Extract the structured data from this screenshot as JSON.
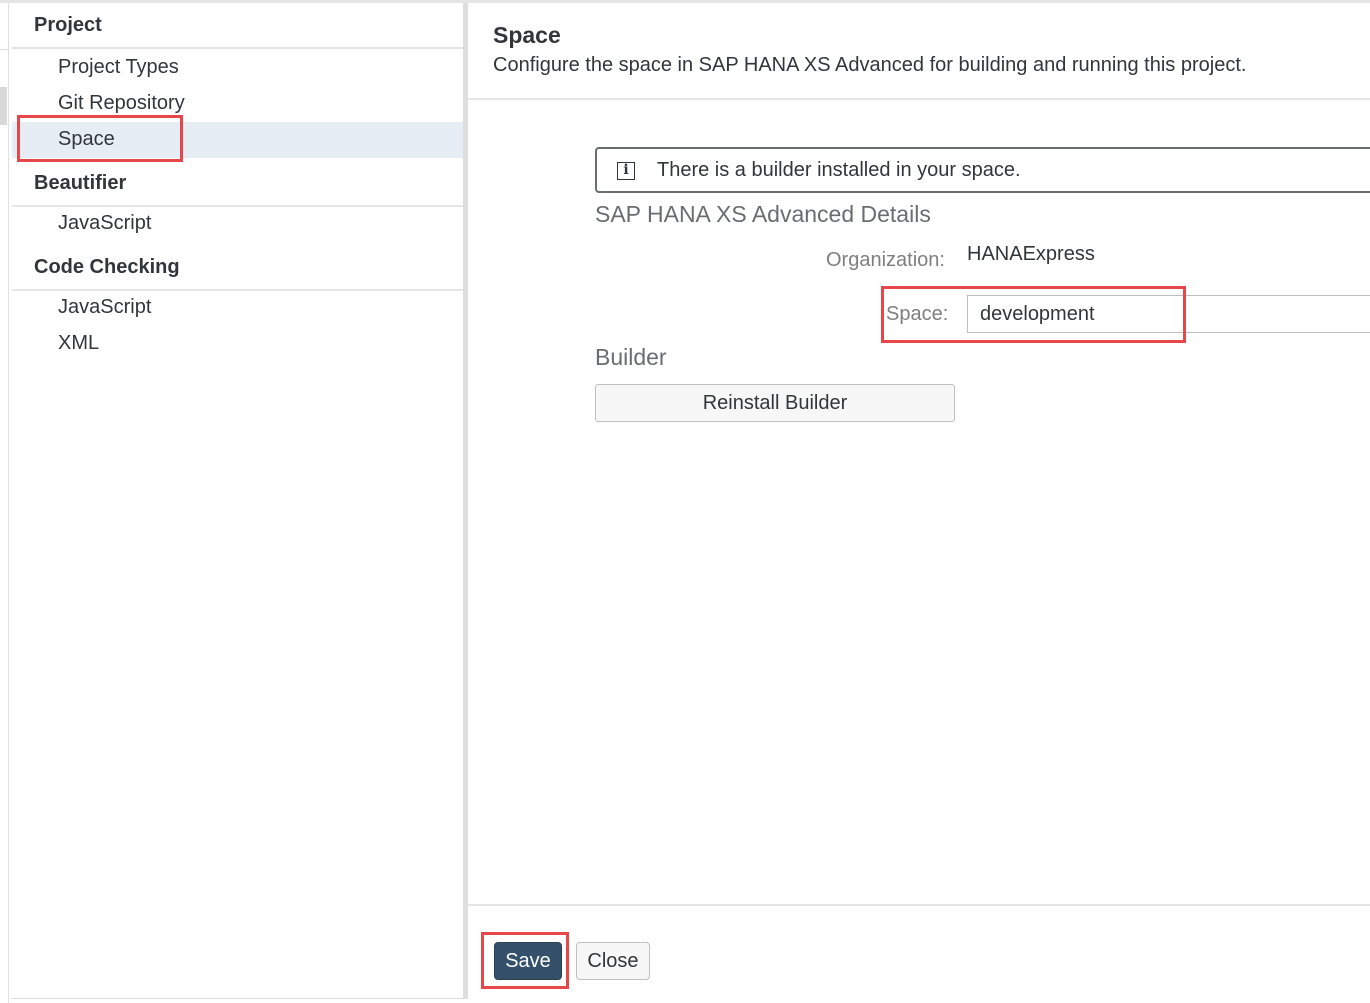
{
  "sidebar": {
    "groups": [
      {
        "title": "Project",
        "items": [
          {
            "label": "Project Types"
          },
          {
            "label": "Git Repository"
          },
          {
            "label": "Space",
            "selected": true
          }
        ]
      },
      {
        "title": "Beautifier",
        "items": [
          {
            "label": "JavaScript"
          }
        ]
      },
      {
        "title": "Code Checking",
        "items": [
          {
            "label": "JavaScript"
          },
          {
            "label": "XML"
          }
        ]
      }
    ]
  },
  "main": {
    "title": "Space",
    "subtitle": "Configure the space in SAP HANA XS Advanced for building and running this project.",
    "info_message": "There is a builder installed in your space.",
    "info_icon": "info-icon",
    "details_title": "SAP HANA XS Advanced Details",
    "organization_label": "Organization:",
    "organization_value": "HANAExpress",
    "space_label": "Space:",
    "space_value": "development",
    "builder_title": "Builder",
    "reinstall_label": "Reinstall Builder"
  },
  "footer": {
    "save_label": "Save",
    "close_label": "Close"
  },
  "colors": {
    "highlight": "#e8474a",
    "selected_bg": "#e6edf5",
    "primary_button": "#34506b"
  }
}
